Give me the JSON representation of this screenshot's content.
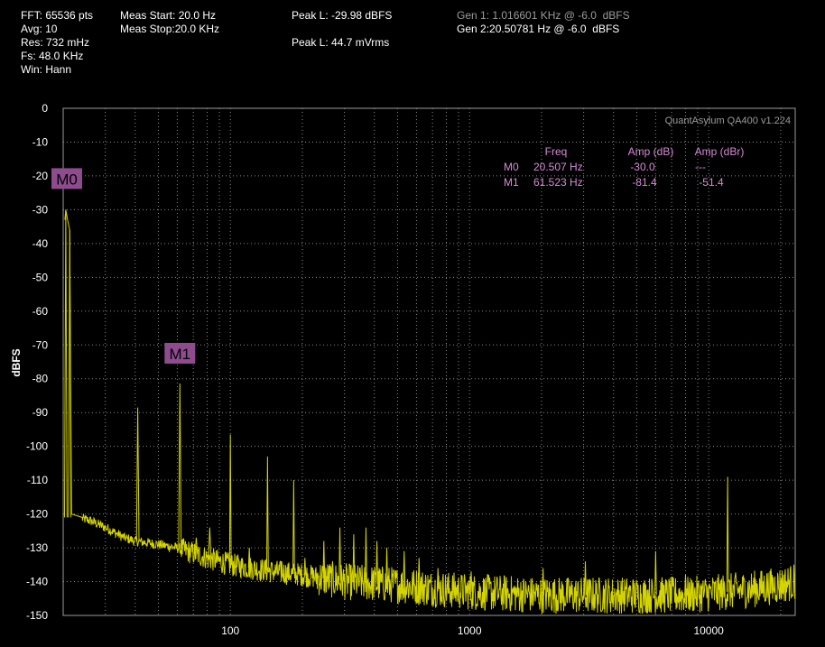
{
  "header": {
    "fft": "FFT: 65536 pts",
    "avg": "Avg: 10",
    "res": "Res: 732 mHz",
    "fs": "Fs: 48.0 KHz",
    "win": "Win: Hann",
    "meas_start": "Meas Start: 20.0 Hz",
    "meas_stop": "Meas Stop:20.0 KHz",
    "peak_dbfs": "Peak L: -29.98 dBFS",
    "peak_vrms": "Peak L: 44.7 mVrms",
    "gen1": "Gen 1: 1.016601 KHz @ -6.0  dBFS",
    "gen2": "Gen 2:20.50781 Hz @ -6.0  dBFS"
  },
  "brand": "QuantAsylum QA400 v1.224",
  "colors": {
    "trace": "#d4d400",
    "grid": "#8a8a8a",
    "marker": "#d68ad6",
    "marker_box": "#8e4c8e",
    "background": "#000000"
  },
  "marker_table": {
    "headers": [
      "Freq",
      "Amp (dB)",
      "Amp (dBr)"
    ],
    "rows": [
      {
        "name": "M0",
        "freq": "20.507 Hz",
        "amp_db": "-30.0",
        "amp_dbr": "---"
      },
      {
        "name": "M1",
        "freq": "61.523 Hz",
        "amp_db": "-81.4",
        "amp_dbr": "-51.4"
      }
    ]
  },
  "chart_data": {
    "type": "line",
    "title": "",
    "xlabel": "",
    "ylabel": "dBFS",
    "x_scale": "log",
    "xlim": [
      20,
      23000
    ],
    "ylim": [
      -150,
      0
    ],
    "grid": true,
    "x_ticks": [
      {
        "value": 100,
        "label": "100"
      },
      {
        "value": 1000,
        "label": "1000"
      },
      {
        "value": 10000,
        "label": "10000"
      }
    ],
    "y_ticks": [
      0,
      -10,
      -20,
      -30,
      -40,
      -50,
      -60,
      -70,
      -80,
      -90,
      -100,
      -110,
      -120,
      -130,
      -140,
      -150
    ],
    "markers": [
      {
        "label": "M0",
        "x": 20.507,
        "y": -30.0
      },
      {
        "label": "M1",
        "x": 61.523,
        "y": -81.4
      }
    ],
    "floor": [
      [
        20,
        -122
      ],
      [
        23,
        -121
      ],
      [
        26,
        -122
      ],
      [
        30,
        -124
      ],
      [
        36,
        -127
      ],
      [
        40,
        -128
      ],
      [
        50,
        -129
      ],
      [
        60,
        -130
      ],
      [
        80,
        -133
      ],
      [
        100,
        -135
      ],
      [
        150,
        -137
      ],
      [
        200,
        -138
      ],
      [
        300,
        -140
      ],
      [
        500,
        -141
      ],
      [
        1000,
        -143
      ],
      [
        2000,
        -144
      ],
      [
        4000,
        -144
      ],
      [
        8000,
        -144
      ],
      [
        12000,
        -143
      ],
      [
        16000,
        -142
      ],
      [
        20000,
        -141
      ],
      [
        23000,
        -140
      ]
    ],
    "peaks": [
      {
        "x": 20.507,
        "y": -30.0
      },
      {
        "x": 21.3,
        "y": -36.0
      },
      {
        "x": 41.0,
        "y": -88.5
      },
      {
        "x": 61.523,
        "y": -81.4
      },
      {
        "x": 72,
        "y": -127
      },
      {
        "x": 82,
        "y": -124
      },
      {
        "x": 100,
        "y": -96.5
      },
      {
        "x": 120,
        "y": -130
      },
      {
        "x": 143,
        "y": -103
      },
      {
        "x": 164,
        "y": -134
      },
      {
        "x": 184,
        "y": -110
      },
      {
        "x": 205,
        "y": -133
      },
      {
        "x": 246,
        "y": -128
      },
      {
        "x": 287,
        "y": -124
      },
      {
        "x": 328,
        "y": -126
      },
      {
        "x": 369,
        "y": -124
      },
      {
        "x": 410,
        "y": -128
      },
      {
        "x": 451,
        "y": -130
      },
      {
        "x": 533,
        "y": -131
      },
      {
        "x": 615,
        "y": -133
      },
      {
        "x": 738,
        "y": -136
      },
      {
        "x": 1016,
        "y": -137
      },
      {
        "x": 2030,
        "y": -136
      },
      {
        "x": 3050,
        "y": -134
      },
      {
        "x": 6000,
        "y": -131
      },
      {
        "x": 8000,
        "y": -138
      },
      {
        "x": 12000,
        "y": -109
      }
    ]
  }
}
